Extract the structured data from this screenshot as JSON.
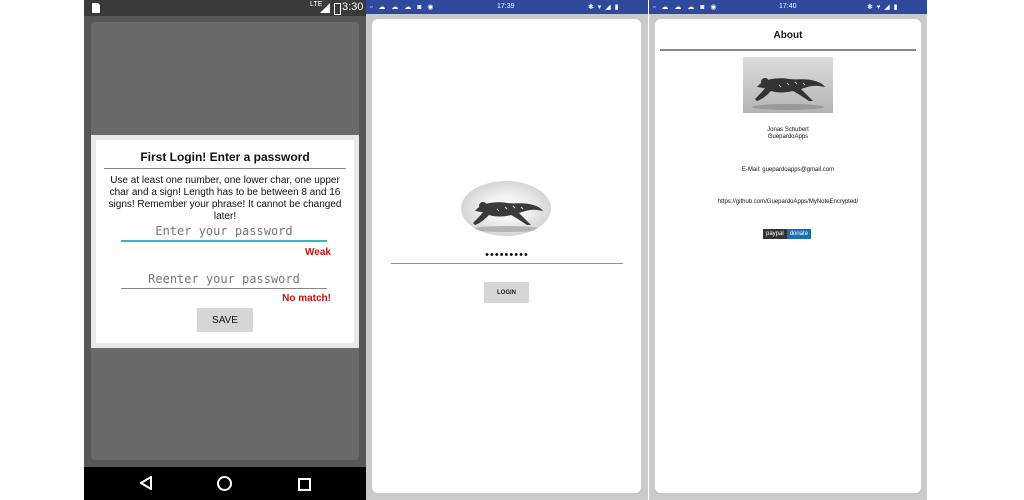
{
  "screen1": {
    "status": {
      "network": "LTE",
      "time": "3:30"
    },
    "dialog": {
      "title": "First Login! Enter a password",
      "instructions": "Use at least one number, one lower char, one upper char and a sign! Length has to be between 8 and 16 signs! Remember your phrase! It cannot be changed later!",
      "password_placeholder": "Enter your password",
      "strength": "Weak",
      "reenter_placeholder": "Reenter your password",
      "match_status": "No match!",
      "save_label": "SAVE"
    },
    "nav": {
      "back": "back-icon",
      "home": "home-icon",
      "recent": "recent-apps-icon"
    },
    "colors": {
      "accent": "#39b3c9",
      "error": "#cc1111"
    }
  },
  "screen2": {
    "status": {
      "left_icons": "▫ ☁ ☁ ☁ ◙ ◉",
      "time": "17:39",
      "right_icons": "✱ ▾ ◢ ▮"
    },
    "password_mask": "•••••••••",
    "login_label": "LOGIN",
    "colors": {
      "statusbar": "#2f4a9c"
    }
  },
  "screen3": {
    "status": {
      "left_icons": "▫ ☁ ☁ ☁ ◙ ◉",
      "time": "17:40",
      "right_icons": "✱ ▾ ◢ ▮"
    },
    "title": "About",
    "author_name": "Jonas Schubert",
    "company": "GuepardoApps",
    "email": "E-Mail: guepardoapps@gmail.com",
    "github": "https://github.com/GuepardoApps/MyNoteEncrypted/",
    "paypal_left": "paypal",
    "paypal_right": "donate"
  }
}
